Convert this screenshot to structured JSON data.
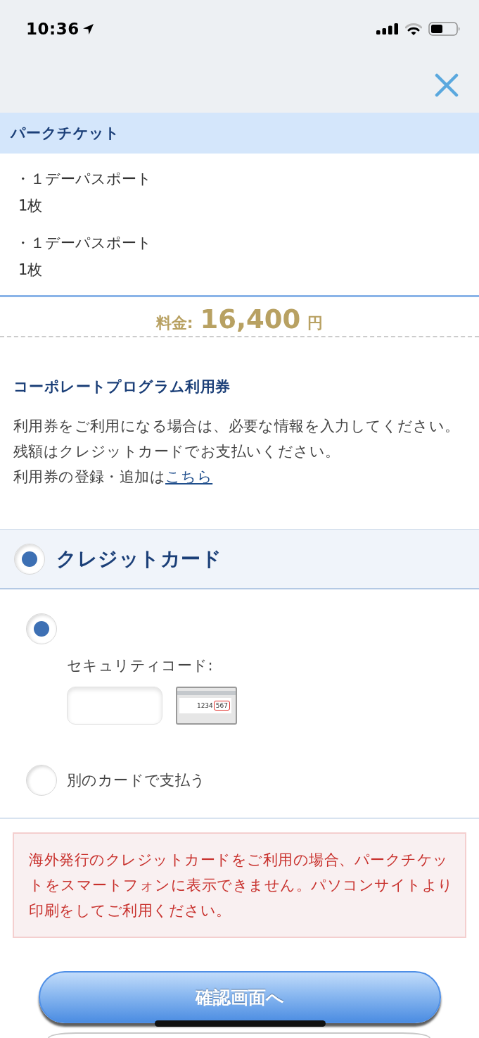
{
  "status_bar": {
    "time": "10:36"
  },
  "section": {
    "title": "パークチケット"
  },
  "tickets": [
    {
      "name": "・１デーパスポート",
      "quantity": "1枚"
    },
    {
      "name": "・１デーパスポート",
      "quantity": "1枚"
    }
  ],
  "price": {
    "label": "料金:",
    "amount": "16,400",
    "unit": "円"
  },
  "corporate": {
    "title": "コーポレートプログラム利用券",
    "lines": [
      "利用券をご利用になる場合は、必要な情報を入力してください。",
      "残額はクレジットカードでお支払いください。"
    ],
    "link_prefix": "利用券の登録・追加は",
    "link": "こちら"
  },
  "payment_method": {
    "label": "クレジットカード",
    "selected": true
  },
  "card_options": [
    {
      "kind": "saved",
      "selected": true,
      "security_label": "セキュリティコード:",
      "sample_number": "1234",
      "sample_code": "567"
    },
    {
      "kind": "other",
      "selected": false,
      "label": "別のカードで支払う"
    }
  ],
  "warning": "海外発行のクレジットカードをご利用の場合、パークチケットをスマートフォンに表示できません。パソコンサイトより印刷をしてご利用ください。",
  "confirm_button": "確認画面へ"
}
